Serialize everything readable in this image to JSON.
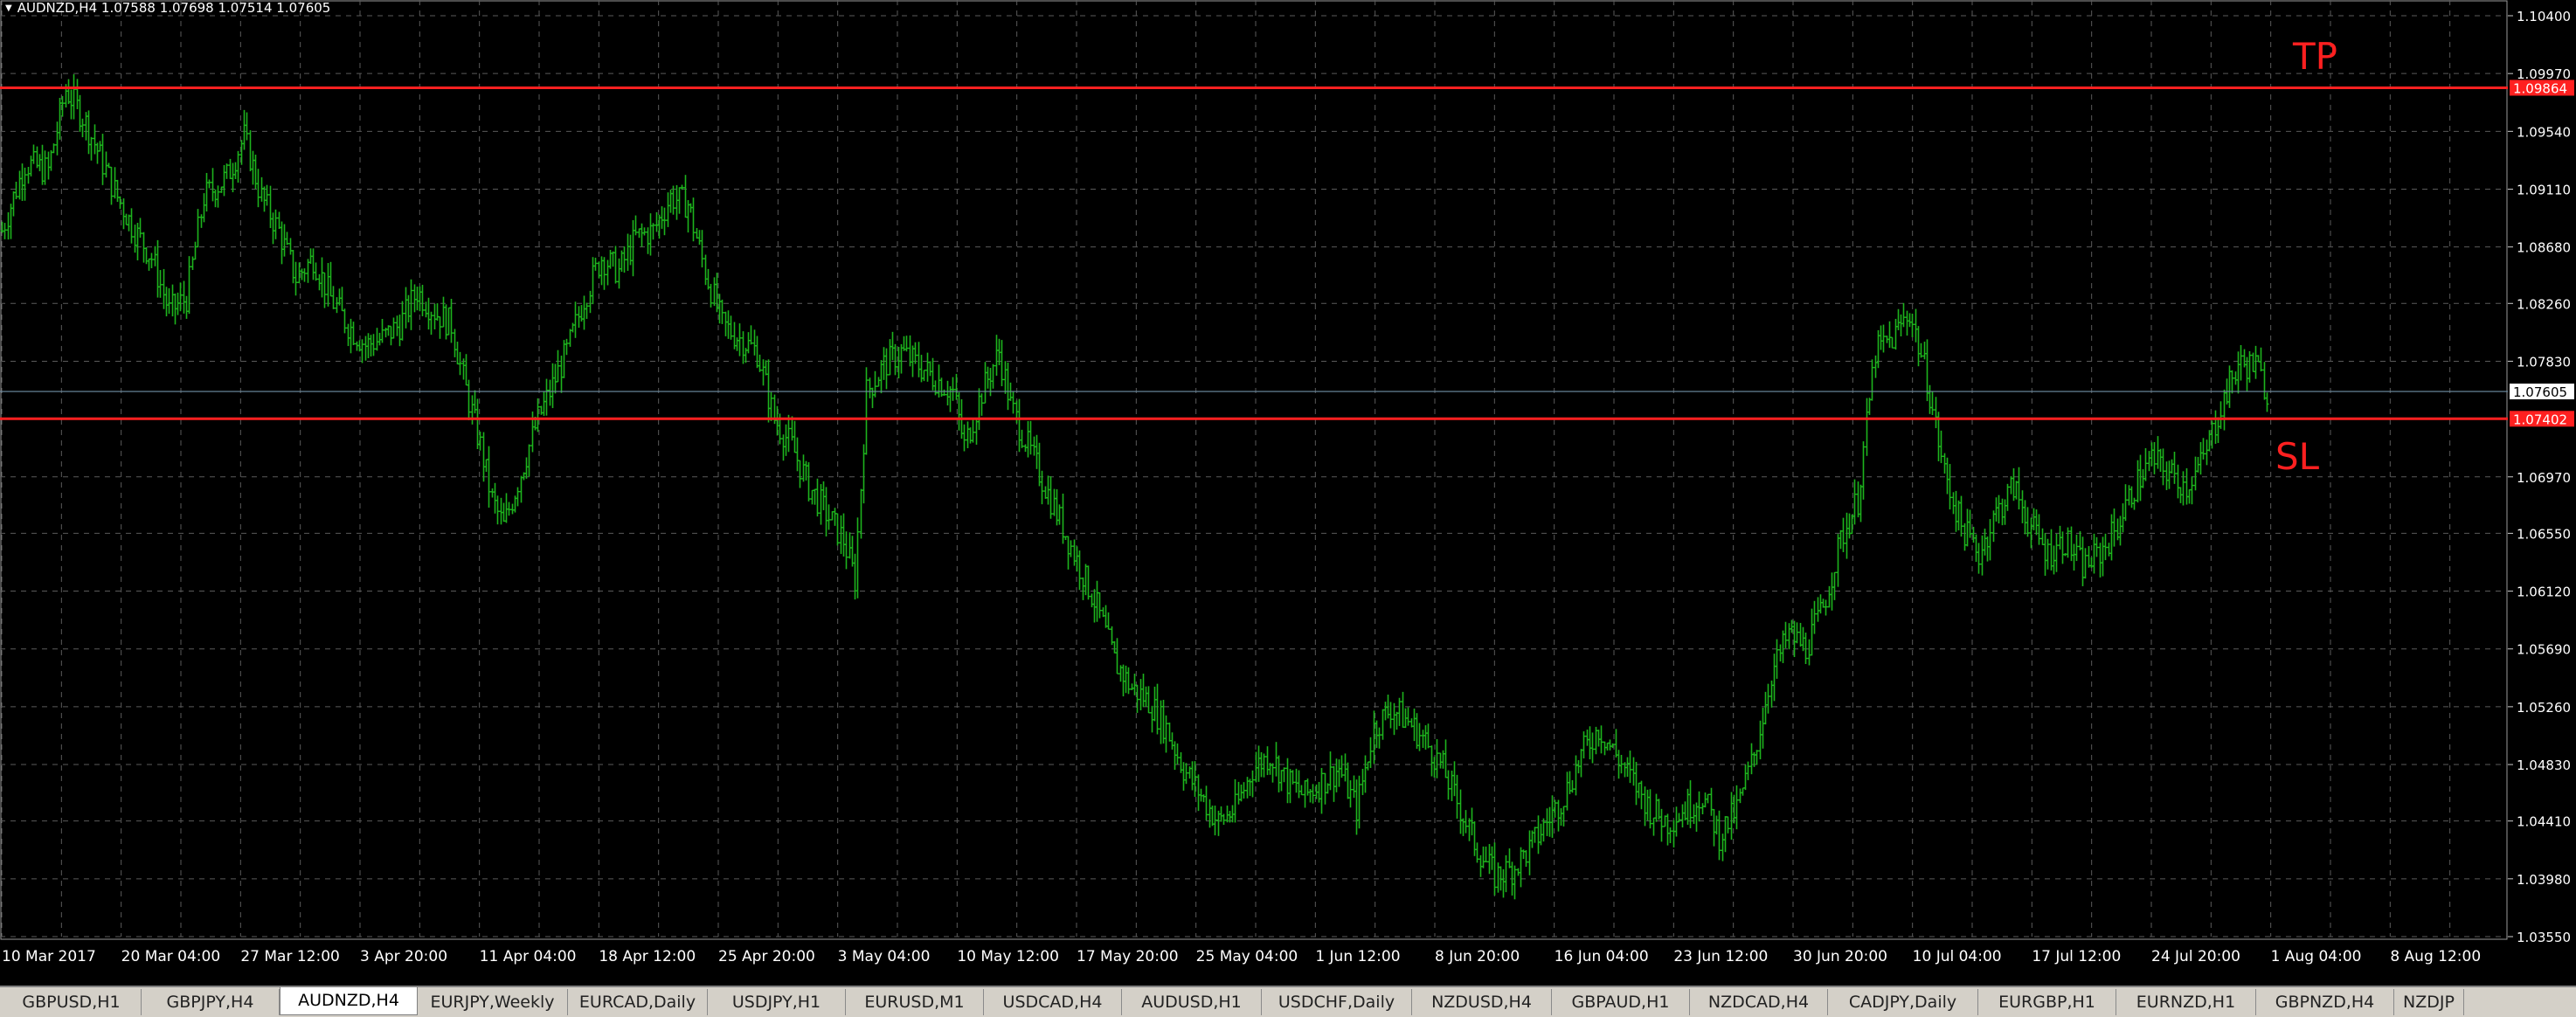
{
  "chart_header": "AUDNZD,H4  1.07588 1.07698 1.07514 1.07605",
  "annotations": {
    "tp_label": "TP",
    "sl_label": "SL"
  },
  "colors": {
    "background": "#000000",
    "grid": "#5a5a5a",
    "candle": "#1db31d",
    "level_line": "#ff2020",
    "bid_line": "#6f8fa6",
    "axis_text": "#ffffff",
    "tab_bar": "#d4d0c8",
    "tab_active": "#ffffff"
  },
  "chart_data": {
    "type": "bar",
    "symbol": "AUDNZD",
    "timeframe": "H4",
    "ylim": [
      1.0355,
      1.104
    ],
    "grid": true,
    "y_tick_labels": [
      "1.10400",
      "1.09970",
      "1.09540",
      "1.09110",
      "1.08680",
      "1.08260",
      "1.07830",
      "1.06970",
      "1.06550",
      "1.06120",
      "1.05690",
      "1.05260",
      "1.04830",
      "1.04410",
      "1.03980",
      "1.03550"
    ],
    "x_tick_labels": [
      "10 Mar 2017",
      "20 Mar 04:00",
      "27 Mar 12:00",
      "3 Apr 20:00",
      "11 Apr 04:00",
      "18 Apr 12:00",
      "25 Apr 20:00",
      "3 May 04:00",
      "10 May 12:00",
      "17 May 20:00",
      "25 May 04:00",
      "1 Jun 12:00",
      "8 Jun 20:00",
      "16 Jun 04:00",
      "23 Jun 12:00",
      "30 Jun 20:00",
      "10 Jul 04:00",
      "17 Jul 12:00",
      "24 Jul 20:00",
      "1 Aug 04:00",
      "8 Aug 12:00"
    ],
    "levels": [
      {
        "label": "TP",
        "price": "1.09864",
        "value": 1.09864
      },
      {
        "label": "SL",
        "price": "1.07402",
        "value": 1.07402
      }
    ],
    "bid": {
      "price": "1.07605",
      "value": 1.07605
    },
    "close_path": [
      [
        0,
        1.088
      ],
      [
        8,
        1.093
      ],
      [
        16,
        1.0925
      ],
      [
        22,
        1.0985
      ],
      [
        28,
        1.0965
      ],
      [
        34,
        1.0935
      ],
      [
        40,
        1.0905
      ],
      [
        46,
        1.088
      ],
      [
        52,
        1.086
      ],
      [
        58,
        1.082
      ],
      [
        64,
        1.083
      ],
      [
        70,
        1.0905
      ],
      [
        78,
        1.092
      ],
      [
        84,
        1.095
      ],
      [
        90,
        1.0905
      ],
      [
        96,
        1.088
      ],
      [
        102,
        1.0845
      ],
      [
        108,
        1.086
      ],
      [
        114,
        1.083
      ],
      [
        120,
        1.081
      ],
      [
        126,
        1.0795
      ],
      [
        132,
        1.08
      ],
      [
        138,
        1.081
      ],
      [
        144,
        1.0835
      ],
      [
        150,
        1.082
      ],
      [
        156,
        1.081
      ],
      [
        160,
        1.077
      ],
      [
        166,
        1.072
      ],
      [
        170,
        1.068
      ],
      [
        174,
        1.066
      ],
      [
        180,
        1.07
      ],
      [
        186,
        1.074
      ],
      [
        190,
        1.076
      ],
      [
        196,
        1.079
      ],
      [
        202,
        1.083
      ],
      [
        208,
        1.086
      ],
      [
        214,
        1.085
      ],
      [
        220,
        1.0875
      ],
      [
        226,
        1.088
      ],
      [
        232,
        1.0905
      ],
      [
        238,
        1.09
      ],
      [
        244,
        1.085
      ],
      [
        250,
        1.081
      ],
      [
        256,
        1.08
      ],
      [
        262,
        1.079
      ],
      [
        268,
        1.074
      ],
      [
        274,
        1.072
      ],
      [
        280,
        1.069
      ],
      [
        286,
        1.067
      ],
      [
        292,
        1.065
      ],
      [
        296,
        1.062
      ],
      [
        300,
        1.076
      ],
      [
        306,
        1.078
      ],
      [
        312,
        1.079
      ],
      [
        318,
        1.078
      ],
      [
        324,
        1.077
      ],
      [
        330,
        1.076
      ],
      [
        334,
        1.072
      ],
      [
        340,
        1.076
      ],
      [
        346,
        1.079
      ],
      [
        350,
        1.075
      ],
      [
        356,
        1.072
      ],
      [
        362,
        1.069
      ],
      [
        368,
        1.066
      ],
      [
        374,
        1.063
      ],
      [
        380,
        1.06
      ],
      [
        386,
        1.056
      ],
      [
        392,
        1.054
      ],
      [
        398,
        1.053
      ],
      [
        404,
        1.051
      ],
      [
        410,
        1.048
      ],
      [
        416,
        1.046
      ],
      [
        422,
        1.044
      ],
      [
        428,
        1.045
      ],
      [
        434,
        1.048
      ],
      [
        440,
        1.049
      ],
      [
        446,
        1.047
      ],
      [
        452,
        1.046
      ],
      [
        458,
        1.047
      ],
      [
        464,
        1.048
      ],
      [
        470,
        1.045
      ],
      [
        476,
        1.051
      ],
      [
        482,
        1.0525
      ],
      [
        488,
        1.0515
      ],
      [
        494,
        1.05
      ],
      [
        500,
        1.048
      ],
      [
        506,
        1.045
      ],
      [
        512,
        1.042
      ],
      [
        518,
        1.04
      ],
      [
        524,
        1.0405
      ],
      [
        530,
        1.042
      ],
      [
        536,
        1.044
      ],
      [
        542,
        1.046
      ],
      [
        548,
        1.049
      ],
      [
        554,
        1.051
      ],
      [
        560,
        1.049
      ],
      [
        566,
        1.047
      ],
      [
        572,
        1.045
      ],
      [
        578,
        1.044
      ],
      [
        584,
        1.045
      ],
      [
        590,
        1.046
      ],
      [
        596,
        1.043
      ],
      [
        602,
        1.045
      ],
      [
        608,
        1.049
      ],
      [
        614,
        1.055
      ],
      [
        620,
        1.058
      ],
      [
        626,
        1.057
      ],
      [
        632,
        1.06
      ],
      [
        638,
        1.065
      ],
      [
        644,
        1.068
      ],
      [
        650,
        1.079
      ],
      [
        656,
        1.08
      ],
      [
        662,
        1.082
      ],
      [
        668,
        1.077
      ],
      [
        674,
        1.07
      ],
      [
        680,
        1.066
      ],
      [
        686,
        1.064
      ],
      [
        692,
        1.067
      ],
      [
        698,
        1.069
      ],
      [
        704,
        1.066
      ],
      [
        710,
        1.064
      ],
      [
        716,
        1.065
      ],
      [
        722,
        1.063
      ],
      [
        728,
        1.064
      ],
      [
        734,
        1.066
      ],
      [
        740,
        1.069
      ],
      [
        746,
        1.071
      ],
      [
        752,
        1.07
      ],
      [
        758,
        1.069
      ],
      [
        764,
        1.071
      ],
      [
        770,
        1.075
      ],
      [
        776,
        1.078
      ],
      [
        782,
        1.078
      ],
      [
        786,
        1.07605
      ]
    ]
  },
  "tabs": [
    {
      "label": "GBPUSD,H1"
    },
    {
      "label": "GBPJPY,H4"
    },
    {
      "label": "AUDNZD,H4",
      "active": true
    },
    {
      "label": "EURJPY,Weekly"
    },
    {
      "label": "EURCAD,Daily"
    },
    {
      "label": "USDJPY,H1"
    },
    {
      "label": "EURUSD,M1"
    },
    {
      "label": "USDCAD,H4"
    },
    {
      "label": "AUDUSD,H1"
    },
    {
      "label": "USDCHF,Daily"
    },
    {
      "label": "NZDUSD,H4"
    },
    {
      "label": "GBPAUD,H1"
    },
    {
      "label": "NZDCAD,H4"
    },
    {
      "label": "CADJPY,Daily"
    },
    {
      "label": "EURGBP,H1"
    },
    {
      "label": "EURNZD,H1"
    },
    {
      "label": "GBPNZD,H4"
    },
    {
      "label": "NZDJP"
    }
  ]
}
